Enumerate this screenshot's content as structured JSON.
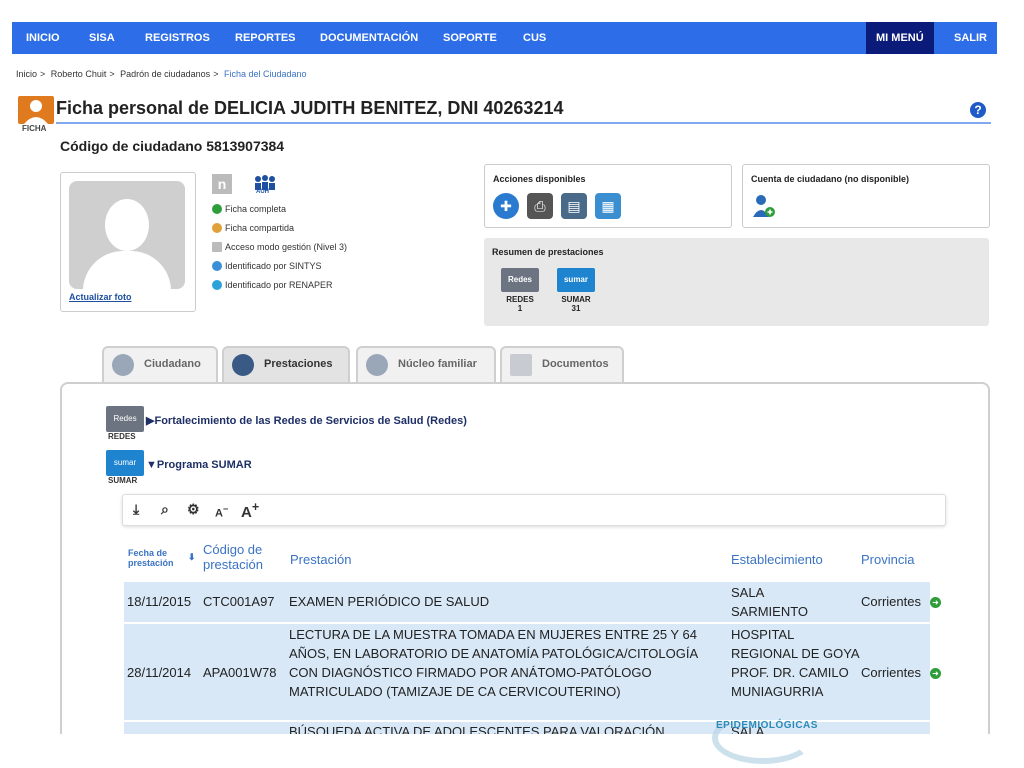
{
  "nav": {
    "items": [
      "INICIO",
      "SISA",
      "REGISTROS",
      "REPORTES",
      "DOCUMENTACIÓN",
      "SOPORTE",
      "CUS"
    ],
    "mi_menu": "MI MENÚ",
    "salir": "SALIR"
  },
  "breadcrumb": {
    "items": [
      "Inicio",
      "Roberto Chuit",
      "Padrón de ciudadanos"
    ],
    "current": "Ficha del Ciudadano"
  },
  "ficha_icon_label": "FICHA",
  "title": "Ficha personal de DELICIA JUDITH BENITEZ, DNI 40263214",
  "codigo": "Código de ciudadano 5813907384",
  "photo_link": "Actualizar foto",
  "auh_label": "AUH",
  "status": [
    "Ficha completa",
    "Ficha compartida",
    "Acceso modo gestión (Nivel 3)",
    "Identificado por SINTYS",
    "Identificado por RENAPER"
  ],
  "acciones_title": "Acciones disponibles",
  "cuenta_title": "Cuenta de ciudadano (no disponible)",
  "resumen": {
    "title": "Resumen de prestaciones",
    "items": [
      {
        "name": "REDES",
        "count": "1"
      },
      {
        "name": "SUMAR",
        "count": "31"
      }
    ]
  },
  "tabs": [
    "Ciudadano",
    "Prestaciones",
    "Núcleo familiar",
    "Documentos"
  ],
  "programs": {
    "redes": {
      "label": "REDES",
      "title": "Fortalecimiento de las Redes de Servicios de Salud (Redes)"
    },
    "sumar": {
      "label": "SUMAR",
      "title": "Programa SUMAR"
    }
  },
  "logos": {
    "redes": "Redes",
    "sumar": "sumar"
  },
  "toolbar": {
    "font_smaller": "A",
    "font_smaller_sign": "−",
    "font_larger": "A",
    "font_larger_sign": "+"
  },
  "table": {
    "headers": {
      "fecha": "Fecha de prestación",
      "codigo": "Código de prestación",
      "prestacion": "Prestación",
      "establecimiento": "Establecimiento",
      "provincia": "Provincia"
    },
    "rows": [
      {
        "fecha": "18/11/2015",
        "codigo": "CTC001A97",
        "prestacion": "EXAMEN PERIÓDICO DE SALUD",
        "establecimiento": "SALA SARMIENTO",
        "provincia": "Corrientes"
      },
      {
        "fecha": "28/11/2014",
        "codigo": "APA001W78",
        "prestacion": "LECTURA DE LA MUESTRA TOMADA EN MUJERES ENTRE 25 Y 64 AÑOS, EN LABORATORIO DE ANATOMÍA PATOLÓGICA/CITOLOGÍA CON DIAGNÓSTICO FIRMADO POR ANÁTOMO-PATÓLOGO MATRICULADO (TAMIZAJE DE CA CERVICOUTERINO)",
        "establecimiento": "HOSPITAL REGIONAL DE GOYA PROF. DR. CAMILO MUNIAGURRIA",
        "provincia": "Corrientes"
      },
      {
        "fecha": "",
        "codigo": "",
        "prestacion": "BÚSQUEDA ACTIVA DE ADOLESCENTES PARA VALORACIÓN",
        "establecimiento": "SALA",
        "provincia": ""
      }
    ]
  },
  "footer_brand": "EPIDEMIOLÓGICAS"
}
